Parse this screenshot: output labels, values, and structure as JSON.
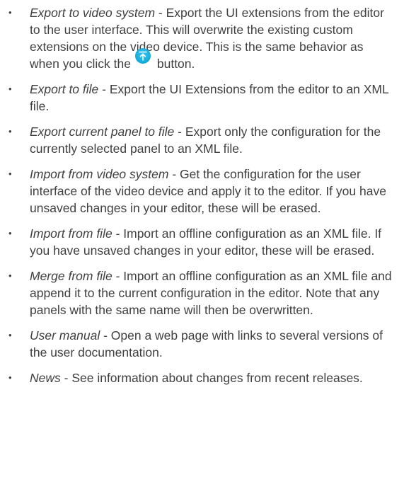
{
  "items": [
    {
      "term": "Export to video system",
      "desc": " - Export the UI extensions from the editor to the user interface. This will overwrite the existing custom extensions on the video device. This is the same behavior as when you click the",
      "after_icon": " button.",
      "icon": "export-upload-icon",
      "icon_color": "#14a9dc"
    },
    {
      "term": "Export to file",
      "desc": " - Export the UI Extensions from the editor to an XML file."
    },
    {
      "term": "Export current panel to file",
      "desc": " - Export only the configuration for the currently selected panel to an XML file."
    },
    {
      "term": "Import from video system",
      "desc": " - Get the configuration for the user interface of the video device and apply it to the editor. If you have unsaved changes in your editor, these will be erased."
    },
    {
      "term": "Import from file",
      "desc": " - Import an offline configuration as an XML file. If you have unsaved changes in your editor, these will be erased."
    },
    {
      "term": "Merge from file",
      "desc": " - Import an offline configuration as an XML file and append it to the current configuration in the editor. Note that any panels with the same name will then be overwritten."
    },
    {
      "term": "User manual",
      "desc": " - Open a web page with links to several versions of the user documentation."
    },
    {
      "term": "News",
      "desc": " - See information about changes from recent releases."
    }
  ],
  "bullet_char": "•",
  "text_color": "#404040"
}
